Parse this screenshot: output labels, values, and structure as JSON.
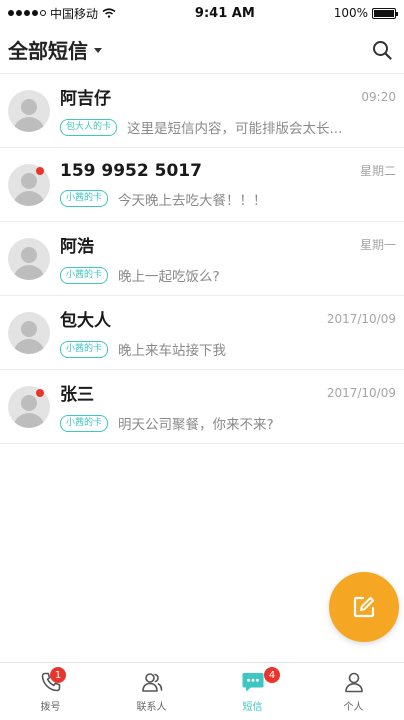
{
  "status_bar": {
    "carrier": "中国移动",
    "time": "9:41 AM",
    "battery": "100%"
  },
  "header": {
    "title": "全部短信"
  },
  "messages": [
    {
      "name": "阿吉仔",
      "time": "09:20",
      "sim": "包大人的卡",
      "preview": "这里是短信内容，可能排版会太长...",
      "unread": false
    },
    {
      "name": "159 9952 5017",
      "time": "星期二",
      "sim": "小茜的卡",
      "preview": "今天晚上去吃大餐！！！",
      "unread": true
    },
    {
      "name": "阿浩",
      "time": "星期一",
      "sim": "小茜的卡",
      "preview": "晚上一起吃饭么?",
      "unread": false
    },
    {
      "name": "包大人",
      "time": "2017/10/09",
      "sim": "小茜的卡",
      "preview": "晚上来车站接下我",
      "unread": false
    },
    {
      "name": "张三",
      "time": "2017/10/09",
      "sim": "小茜的卡",
      "preview": "明天公司聚餐，你来不来?",
      "unread": true
    }
  ],
  "tabs": [
    {
      "label": "拨号",
      "icon": "phone-icon",
      "badge": "1",
      "active": false
    },
    {
      "label": "联系人",
      "icon": "contacts-icon",
      "badge": "",
      "active": false
    },
    {
      "label": "短信",
      "icon": "message-icon",
      "badge": "4",
      "active": true
    },
    {
      "label": "个人",
      "icon": "person-icon",
      "badge": "",
      "active": false
    }
  ],
  "colors": {
    "accent": "#3ec6c0",
    "fab": "#f5a623",
    "badge": "#e8362d"
  }
}
